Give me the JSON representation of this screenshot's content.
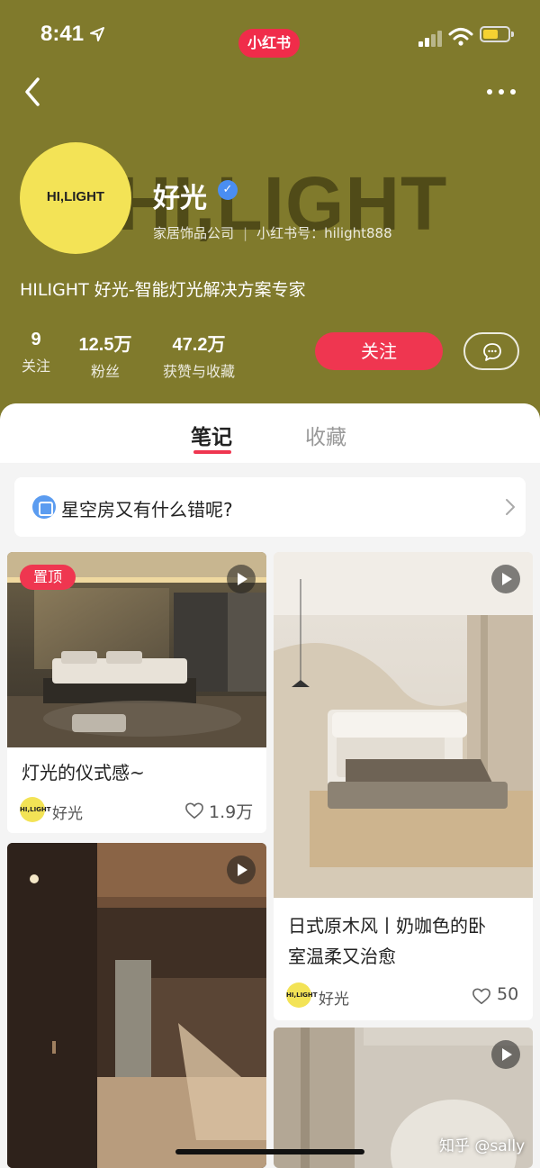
{
  "status_bar": {
    "time": "8:41"
  },
  "app_badge": "小红书",
  "profile": {
    "background_logo": "HI,LIGHT",
    "avatar_text": "HI,LIGHT",
    "name": "好光",
    "category": "家居饰品公司",
    "xhs_id": "小红书号：hilight888",
    "bio": "HILIGHT 好光-智能灯光解决方案专家",
    "stats": [
      {
        "num": "9",
        "label": "关注"
      },
      {
        "num": "12.5万",
        "label": "粉丝"
      },
      {
        "num": "47.2万",
        "label": "获赞与收藏"
      }
    ],
    "follow_label": "关注"
  },
  "tabs": {
    "notes": "笔记",
    "collections": "收藏"
  },
  "topic": {
    "text": "星空房又有什么错呢?"
  },
  "notes": [
    {
      "pinned_label": "置顶",
      "title": "灯光的仪式感~",
      "author": "好光",
      "avatar_text": "HI,LIGHT",
      "likes": "1.9万"
    },
    {
      "title_line1": "日式原木风丨奶咖色的卧",
      "title_line2": "室温柔又治愈",
      "author": "好光",
      "avatar_text": "HI,LIGHT",
      "likes": "50"
    }
  ],
  "watermark": "知乎 @sally",
  "colors": {
    "header_bg": "#807a2c",
    "accent": "#ef3650",
    "avatar_yellow": "#f3e356",
    "verified_blue": "#4a8ef2"
  },
  "icons": [
    "location-arrow-icon",
    "signal-icon",
    "wifi-icon",
    "battery-icon",
    "back-icon",
    "more-icon",
    "verified-icon",
    "chat-bubble-icon",
    "topic-icon",
    "chevron-right-icon",
    "play-icon",
    "heart-icon"
  ]
}
